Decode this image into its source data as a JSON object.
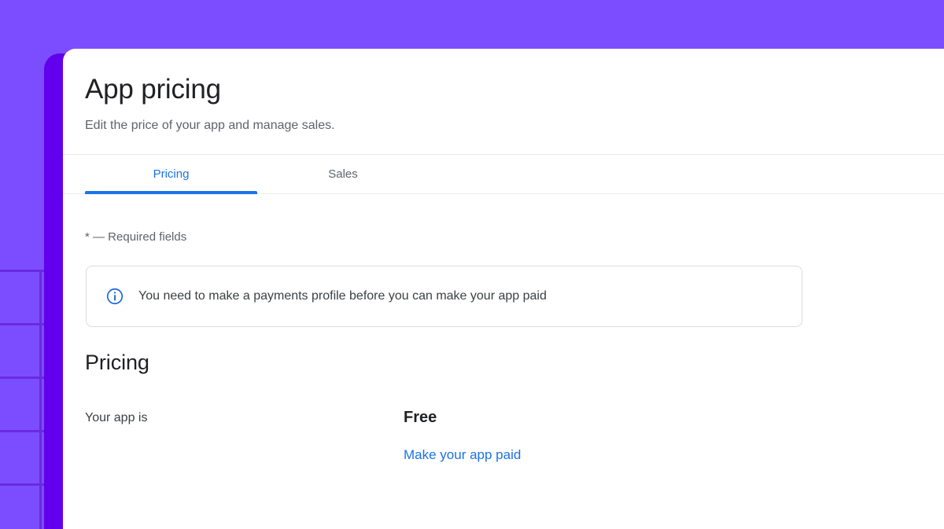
{
  "theme": {
    "background_purple": "#7c4dff",
    "backdrop_purple_dark": "#6200ee",
    "grid_line_purple": "#6a2ae0",
    "accent_blue": "#1a73e8",
    "text_primary": "#202124",
    "text_secondary": "#5f6368",
    "border_gray": "#dadce0"
  },
  "header": {
    "title": "App pricing",
    "subtitle": "Edit the price of your app and manage sales."
  },
  "tabs": [
    {
      "id": "pricing",
      "label": "Pricing",
      "active": true
    },
    {
      "id": "sales",
      "label": "Sales",
      "active": false
    }
  ],
  "content": {
    "required_fields_note": "* — Required fields",
    "info_banner": {
      "icon": "info-circle-icon",
      "message": "You need to make a payments profile before you can make your app paid"
    },
    "pricing_section": {
      "heading": "Pricing",
      "rows": [
        {
          "label": "Your app is",
          "value": "Free",
          "action_label": "Make your app paid"
        }
      ]
    }
  }
}
